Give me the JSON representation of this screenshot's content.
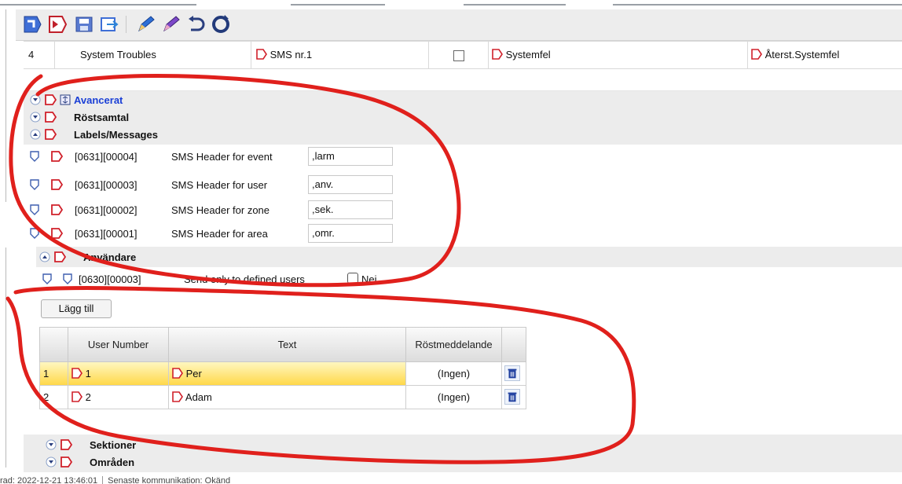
{
  "toolbar": {
    "buttons": [
      "export-icon",
      "import-icon",
      "save-icon",
      "send-icon",
      "pen-icon",
      "pen-blue-icon",
      "undo-icon",
      "refresh-icon"
    ]
  },
  "trouble_row": {
    "index": "4",
    "name": "System Troubles",
    "channel": "SMS nr.1",
    "checkbox_checked": false,
    "message": "Systemfel",
    "restore_message": "Återst.Systemfel"
  },
  "sections": {
    "avancerat": "Avancerat",
    "rostsamtal": "Röstsamtal",
    "labels_messages": "Labels/Messages",
    "anvandare": "Användare",
    "sektioner": "Sektioner",
    "omraden": "Områden"
  },
  "label_rows": [
    {
      "code": "[0631][00004]",
      "name": "SMS Header for event",
      "value": ",larm"
    },
    {
      "code": "[0631][00003]",
      "name": "SMS Header for user",
      "value": ",anv."
    },
    {
      "code": "[0631][00002]",
      "name": "SMS Header for zone",
      "value": ",sek."
    },
    {
      "code": "[0631][00001]",
      "name": "SMS Header for area",
      "value": ",omr."
    }
  ],
  "user_option": {
    "code": "[0630][00003]",
    "name": "Send only to defined users",
    "checkbox_label": "Nej",
    "checked": false
  },
  "add_button": "Lägg till",
  "users_table": {
    "headers": [
      "User Number",
      "Text",
      "Röstmeddelande"
    ],
    "rows": [
      {
        "idx": "1",
        "user_number": "1",
        "text": "Per",
        "voice": "(Ingen)",
        "selected": true
      },
      {
        "idx": "2",
        "user_number": "2",
        "text": "Adam",
        "voice": "(Ingen)",
        "selected": false
      }
    ]
  },
  "status_bar": {
    "left": "rad: 2022-12-21 13:46:01",
    "right": "Senaste kommunikation: Okänd"
  },
  "colors": {
    "annotation": "#e0201c",
    "accent_blue": "#1a3fd6",
    "arrow_red": "#d0202a",
    "selected_row": "#ffd84a"
  }
}
